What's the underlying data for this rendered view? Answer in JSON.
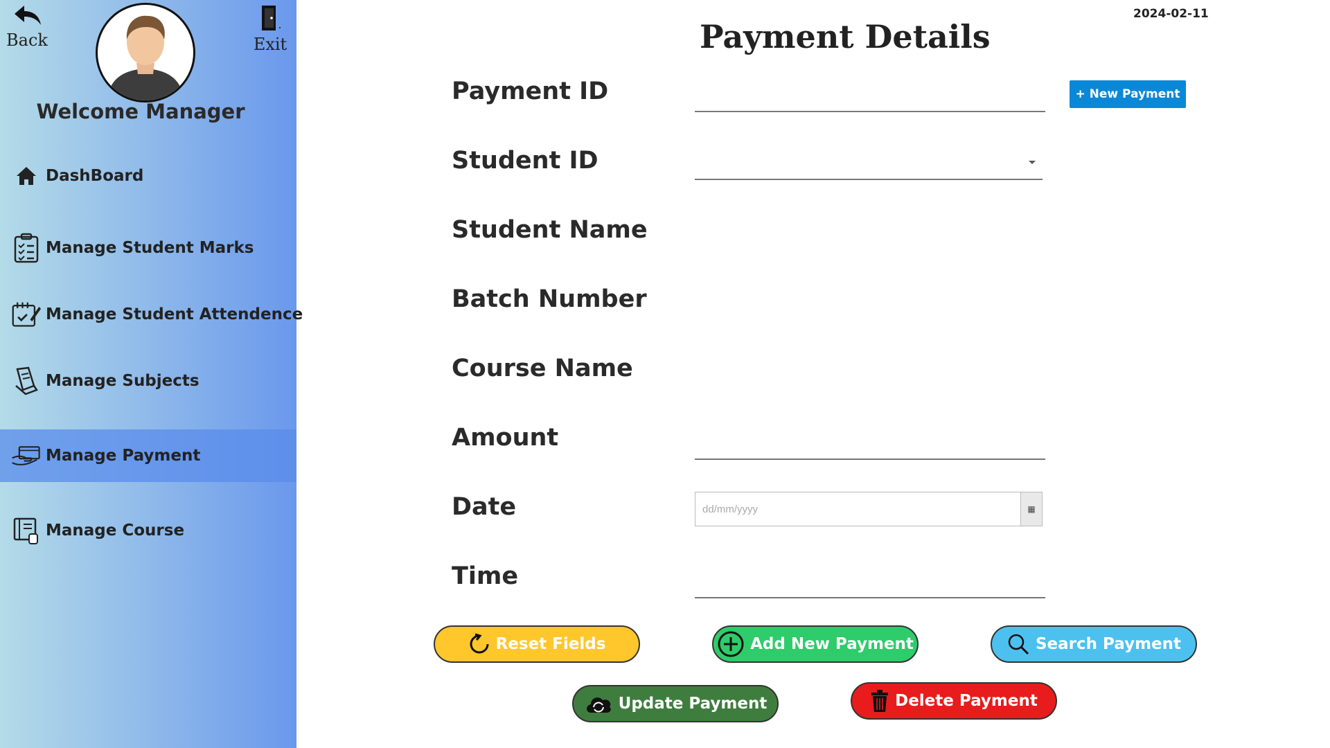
{
  "header": {
    "date": "2024-02-11",
    "title": "Payment Details"
  },
  "sidebar": {
    "back_label": "Back",
    "exit_label": "Exit",
    "welcome": "Welcome Manager",
    "items": [
      {
        "label": "DashBoard",
        "icon": "home-icon"
      },
      {
        "label": "Manage Student Marks",
        "icon": "clipboard-list-icon"
      },
      {
        "label": "Manage Student Attendence",
        "icon": "calendar-check-icon"
      },
      {
        "label": "Manage Subjects",
        "icon": "book-icon"
      },
      {
        "label": "Manage Payment",
        "icon": "hand-card-icon",
        "active": true
      },
      {
        "label": "Manage Course",
        "icon": "course-book-icon"
      }
    ]
  },
  "form": {
    "payment_id_label": "Payment ID",
    "student_id_label": "Student ID",
    "student_name_label": "Student Name",
    "batch_number_label": "Batch Number",
    "course_name_label": "Course Name",
    "amount_label": "Amount",
    "date_label": "Date",
    "date_placeholder": "dd/mm/yyyy",
    "time_label": "Time",
    "new_payment_label": "+ New Payment"
  },
  "actions": {
    "reset": "Reset Fields",
    "add": "Add New Payment",
    "search": "Search Payment",
    "update": "Update Payment",
    "delete": "Delete Payment"
  },
  "colors": {
    "reset": "#ffc72c",
    "add": "#2ecc6a",
    "search": "#4cc1f0",
    "update": "#3f7d3f",
    "delete": "#e81c1c",
    "new_payment": "#0a88d8"
  }
}
